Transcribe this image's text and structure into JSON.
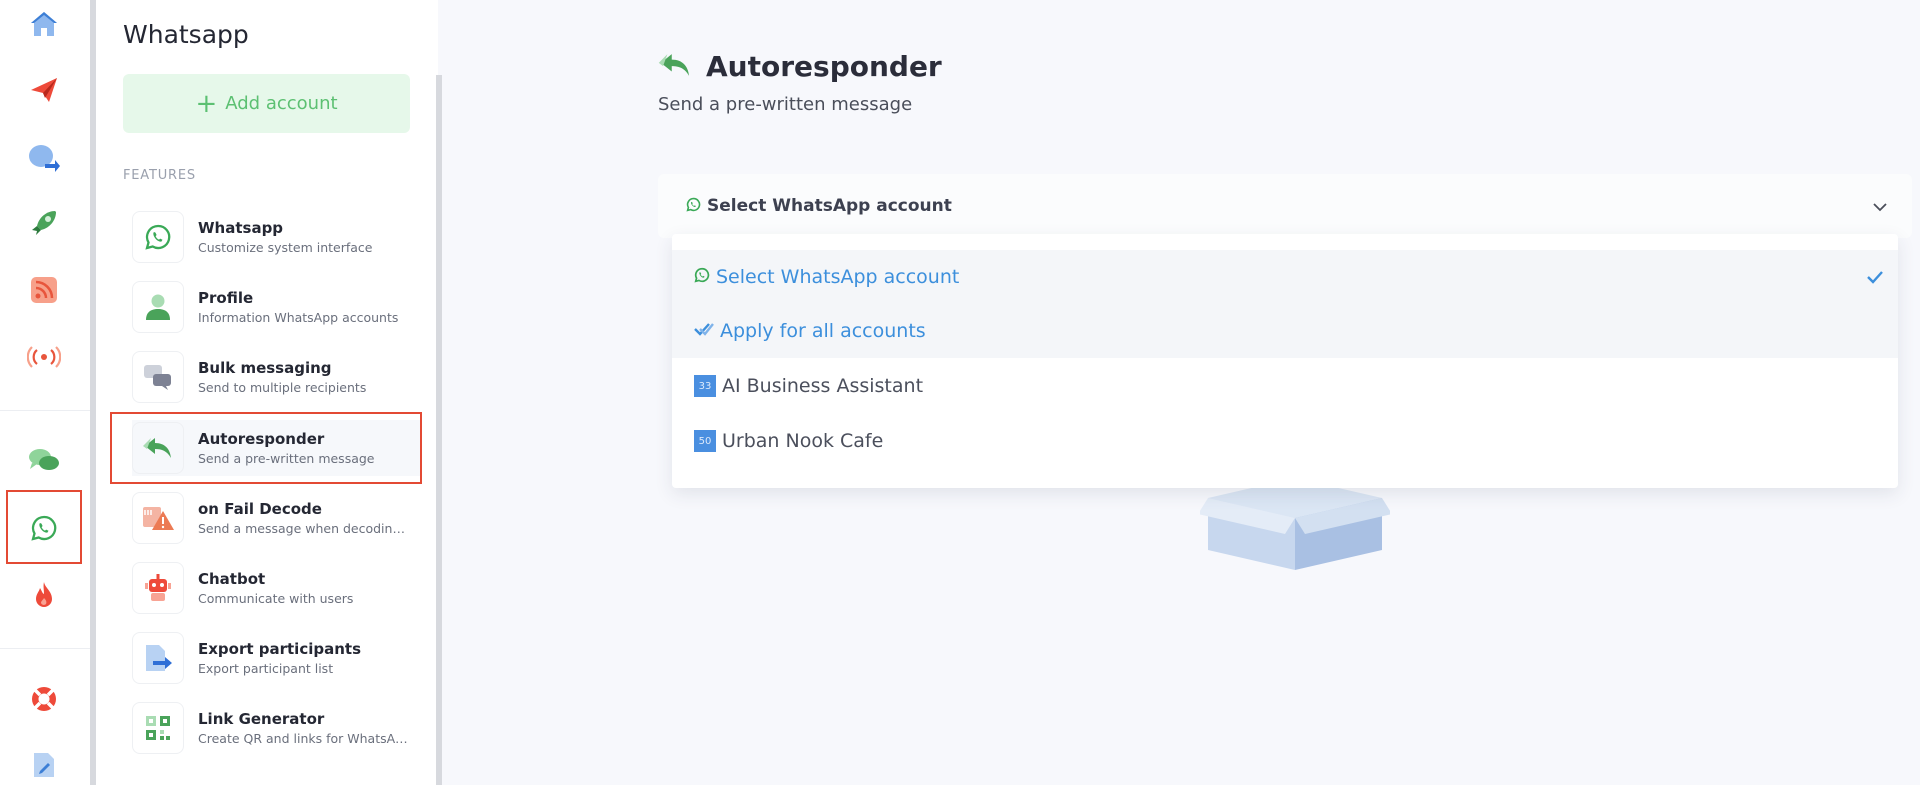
{
  "panel": {
    "title": "Whatsapp",
    "add_account": "Add account",
    "section_label": "FEATURES",
    "features": [
      {
        "name": "Whatsapp",
        "desc": "Customize system interface"
      },
      {
        "name": "Profile",
        "desc": "Information WhatsApp accounts"
      },
      {
        "name": "Bulk messaging",
        "desc": "Send to multiple recipients"
      },
      {
        "name": "Autoresponder",
        "desc": "Send a pre-written message"
      },
      {
        "name": "on Fail Decode",
        "desc": "Send a message when decoding fails"
      },
      {
        "name": "Chatbot",
        "desc": "Communicate with users"
      },
      {
        "name": "Export participants",
        "desc": "Export participant list"
      },
      {
        "name": "Link Generator",
        "desc": "Create QR and links for WhatsApp"
      }
    ]
  },
  "main": {
    "title": "Autoresponder",
    "subtitle": "Send a pre-written message",
    "select": {
      "value": "Select WhatsApp account",
      "options": [
        {
          "label": "Select WhatsApp account",
          "selected": true
        },
        {
          "label": "Apply for all accounts"
        },
        {
          "label": "AI Business Assistant",
          "badge": "33"
        },
        {
          "label": "Urban Nook Cafe",
          "badge": "50"
        }
      ]
    }
  },
  "colors": {
    "accent_green": "#5cc072",
    "accent_blue": "#3c8fdc",
    "highlight_red": "#e34a34"
  }
}
